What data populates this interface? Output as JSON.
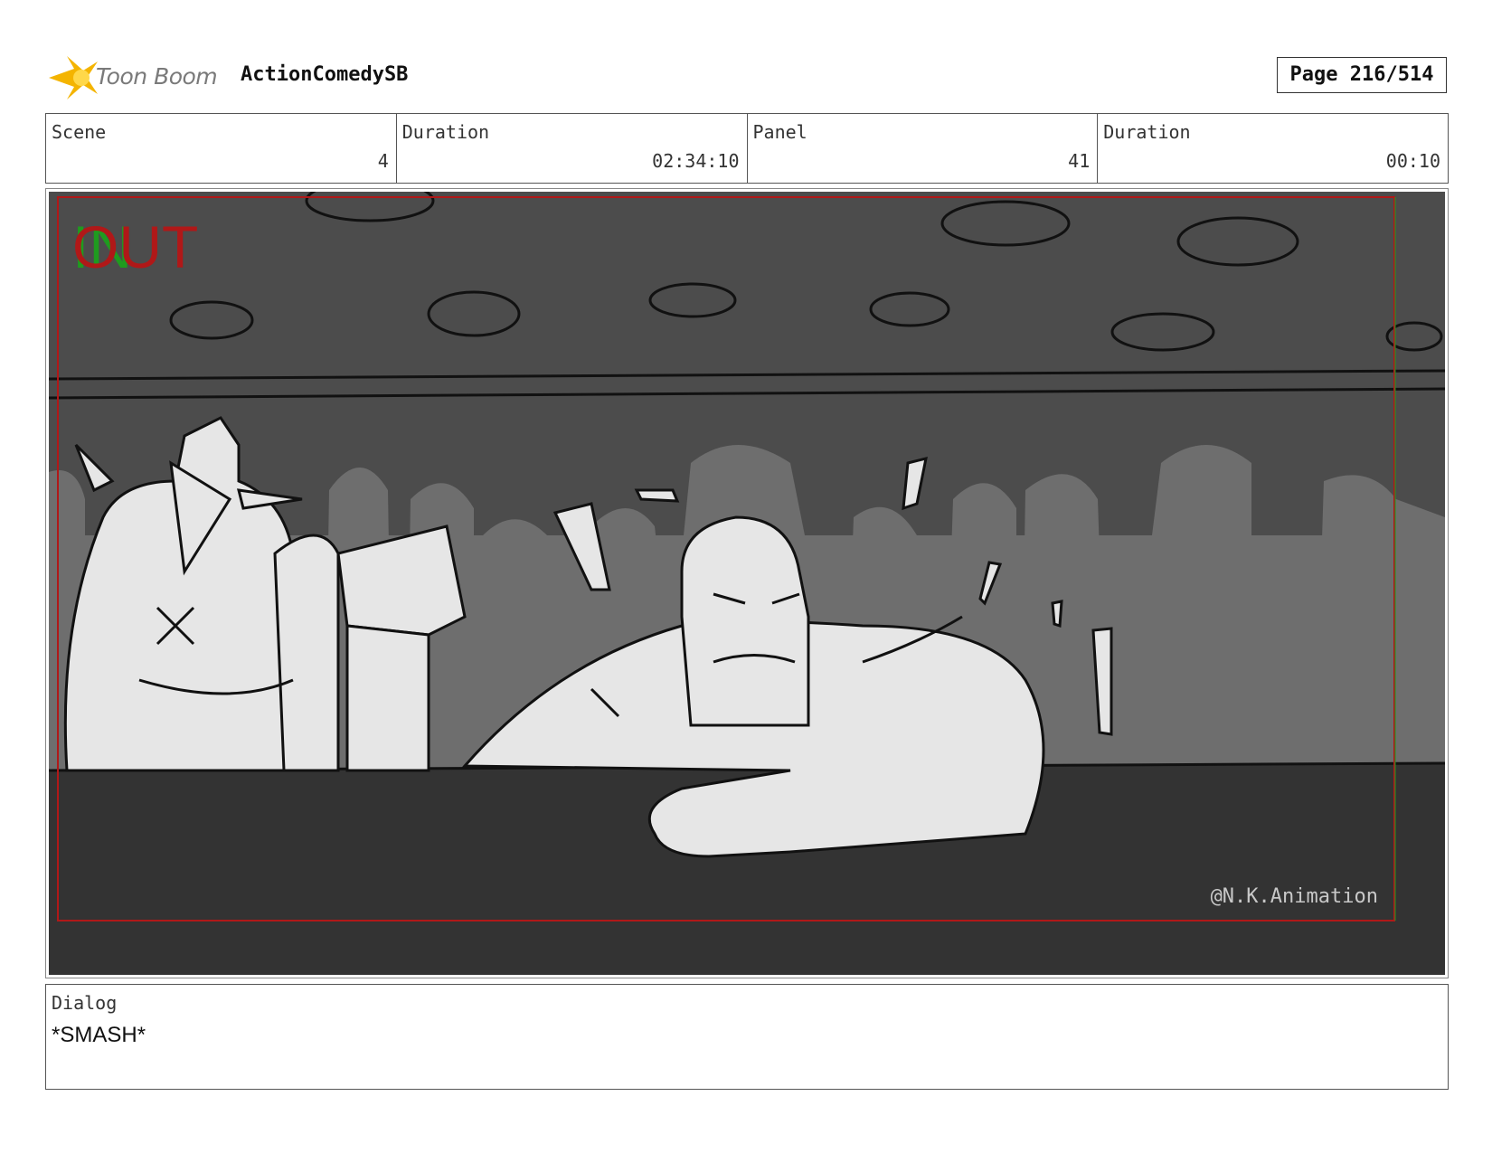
{
  "header": {
    "logo_text": "Toon Boom",
    "project_title": "ActionComedySB",
    "page_label": "Page 216/514"
  },
  "info": {
    "scene_label": "Scene",
    "scene_value": "4",
    "scene_duration_label": "Duration",
    "scene_duration_value": "02:34:10",
    "panel_label": "Panel",
    "panel_value": "41",
    "panel_duration_label": "Duration",
    "panel_duration_value": "00:10"
  },
  "panel": {
    "transition_out": "OUT",
    "transition_in": "IN",
    "watermark": "@N.K.Animation",
    "colors": {
      "background_wall": "#4c4c4c",
      "crowd_silhouettes": "#6e6e6e",
      "counter": "#333333",
      "characters": "#e6e6e6",
      "safe_frame": "#b01818",
      "in_marker": "#1f9b1f"
    }
  },
  "dialog": {
    "label": "Dialog",
    "text": "*SMASH*"
  }
}
